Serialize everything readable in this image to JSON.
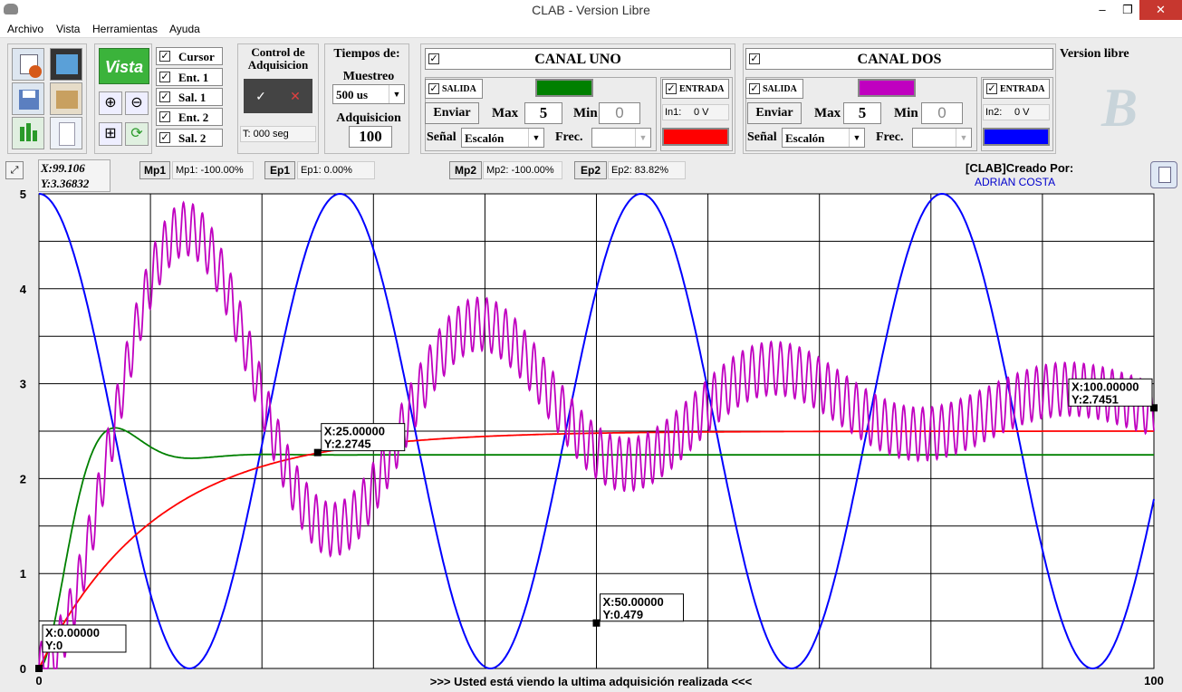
{
  "window": {
    "title": "CLAB - Version Libre",
    "minimize": "–",
    "restore": "❐",
    "close": "✕"
  },
  "menu": [
    "Archivo",
    "Vista",
    "Herramientas",
    "Ayuda"
  ],
  "toolbar": {
    "vista_label": "Vista",
    "icons": [
      "open-icon",
      "save-disk-icon",
      "floppy-icon",
      "package-icon",
      "csv-icon",
      "blank-page-icon"
    ],
    "checks": [
      {
        "label": "Cursor",
        "checked": true
      },
      {
        "label": "Ent. 1",
        "checked": true
      },
      {
        "label": "Sal. 1",
        "checked": true
      },
      {
        "label": "Ent. 2",
        "checked": true
      },
      {
        "label": "Sal. 2",
        "checked": true
      }
    ]
  },
  "control": {
    "title": "Control de Adquisicion",
    "status": "T: 000 seg"
  },
  "tiempos": {
    "title": "Tiempos de:",
    "muestreo_label": "Muestreo",
    "muestreo_value": "500 us",
    "adq_label": "Adquisicion",
    "adq_value": "100"
  },
  "canal1": {
    "title": "CANAL UNO",
    "salida": "SALIDA",
    "entrada": "ENTRADA",
    "enviar": "Enviar",
    "max_label": "Max",
    "max_value": "5",
    "min_label": "Min",
    "min_value": "0",
    "senal_label": "Señal",
    "senal_value": "Escalón",
    "frec_label": "Frec.",
    "in_text": "In1:",
    "in_value": "0 V",
    "out_color": "#008000",
    "in_color": "#ff0000"
  },
  "canal2": {
    "title": "CANAL DOS",
    "salida": "SALIDA",
    "entrada": "ENTRADA",
    "enviar": "Enviar",
    "max_label": "Max",
    "max_value": "5",
    "min_label": "Min",
    "min_value": "0",
    "senal_label": "Señal",
    "senal_value": "Escalón",
    "frec_label": "Frec.",
    "in_text": "In2:",
    "in_value": "0 V",
    "out_color": "#c000c0",
    "in_color": "#0000ff"
  },
  "version": "Version libre",
  "cursor": {
    "x": "X:99.106",
    "y": "Y:3.36832"
  },
  "markers": [
    {
      "btn": "Mp1",
      "val": "Mp1: -100.00%"
    },
    {
      "btn": "Ep1",
      "val": "Ep1: 0.00%"
    },
    {
      "btn": "Mp2",
      "val": "Mp2: -100.00%"
    },
    {
      "btn": "Ep2",
      "val": "Ep2: 83.82%"
    }
  ],
  "credit": {
    "line1": "[CLAB]Creado Por:",
    "line2": "ADRIAN COSTA"
  },
  "status_line": ">>> Usted está viendo la ultima adquisición realizada <<<",
  "chart_data": {
    "type": "line",
    "xlim": [
      0,
      100
    ],
    "ylim": [
      0,
      5
    ],
    "x_ticks": [
      "0",
      "100"
    ],
    "y_ticks": [
      "0",
      "1",
      "2",
      "3",
      "4",
      "5"
    ],
    "grid": true,
    "series": [
      {
        "color": "#0000ff",
        "kind": "sine",
        "offset": 2.5,
        "amplitude": 2.5,
        "period": 27,
        "phase_x": 0
      },
      {
        "color": "#008000",
        "kind": "underdamped",
        "final": 2.25,
        "peak_x": 6,
        "peak": 2.7,
        "settle_x": 20
      },
      {
        "color": "#ff0000",
        "kind": "first-order",
        "final": 2.5,
        "x_at_2_27": 25
      },
      {
        "color": "#c000c0",
        "kind": "oscillating",
        "final": 2.75,
        "peak": 4.4,
        "peak_x": 10
      }
    ],
    "annotations": [
      {
        "x": 0,
        "y": 0,
        "label_x": "X:0.00000",
        "label_y": "Y:0"
      },
      {
        "x": 25,
        "y": 2.2745,
        "label_x": "X:25.00000",
        "label_y": "Y:2.2745"
      },
      {
        "x": 50,
        "y": 0.479,
        "label_x": "X:50.00000",
        "label_y": "Y:0.479"
      },
      {
        "x": 100,
        "y": 2.7451,
        "label_x": "X:100.00000",
        "label_y": "Y:2.7451"
      }
    ]
  }
}
